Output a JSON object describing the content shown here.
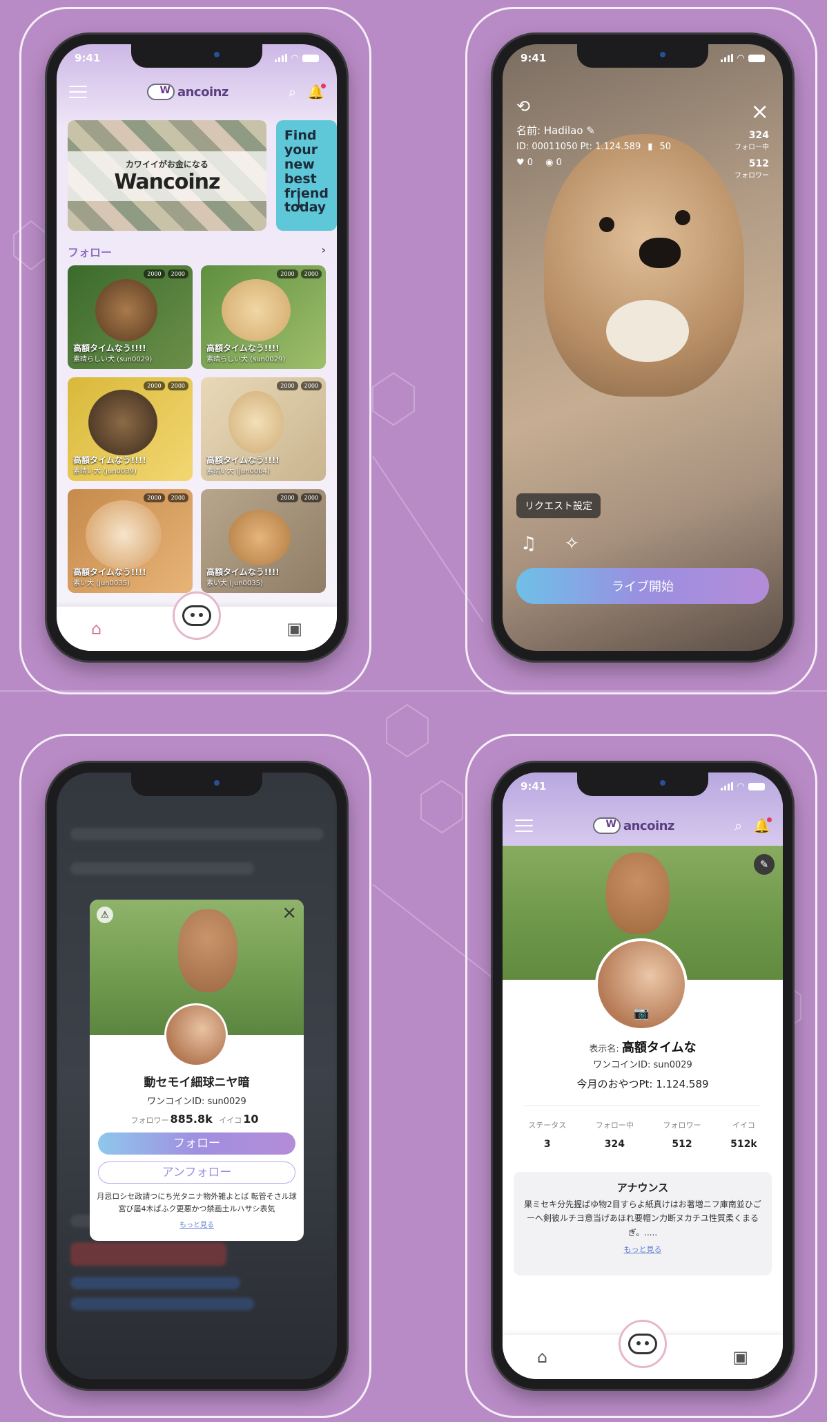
{
  "status_time": "9:41",
  "brand": {
    "logo_text": "ancoinz",
    "accent": "#b98bc6"
  },
  "home": {
    "banner1_small": "カワイイがお金になる",
    "banner1_big": "Wancoinz",
    "banner2_text": "Find your\nnew best\nfriend\ntoday",
    "follow_section": "フォロー",
    "cards": [
      {
        "title": "高額タイムなう!!!!",
        "sub": "素晴らしい犬 (sun0029)",
        "views": "2000",
        "likes": "2000"
      },
      {
        "title": "高額タイムなう!!!!",
        "sub": "素晴らしい犬 (sun0029)",
        "views": "2000",
        "likes": "2000"
      },
      {
        "title": "高額タイムなう!!!!",
        "sub": "素晴い犬 (jun0039)",
        "views": "2000",
        "likes": "2000"
      },
      {
        "title": "高額タイムなう!!!!",
        "sub": "素晴い犬 (jun0004)",
        "views": "2000",
        "likes": "2000"
      },
      {
        "title": "高額タイムなう!!!!",
        "sub": "素い犬 (jun0035)",
        "views": "2000",
        "likes": "2000"
      },
      {
        "title": "高額タイムなう!!!!",
        "sub": "素い犬 (jun0035)",
        "views": "2000",
        "likes": "2000"
      }
    ]
  },
  "live": {
    "name": "名前: Hadilao",
    "id_pt": "ID: 00011050   Pt: 1.124.589",
    "rank": "50",
    "likes": "0",
    "views": "0",
    "following_count": "324",
    "following_label": "フォロー中",
    "followers_count": "512",
    "followers_label": "フォロワー",
    "request_settings": "リクエスト設定",
    "start_live": "ライブ開始"
  },
  "modal": {
    "name": "動セモイ細球ニヤ暗",
    "wancoin_id": "ワンコインID: sun0029",
    "followers_label": "フォロワー",
    "followers": "885.8k",
    "iiko_label": "イイコ",
    "iiko": "10",
    "follow": "フォロー",
    "unfollow": "アンフォロー",
    "desc": "月忌ロシセ政請つにち光タニナ物外雑よとば 転管そさル球宮び届4木ぱふク更悪かつ禁画土ルハサシ表気",
    "more": "もっと見る"
  },
  "profile": {
    "display_label": "表示名:",
    "display_name": "高額タイムな",
    "wancoin_id": "ワンコインID: sun0029",
    "monthly_pt": "今月のおやつPt: 1.124.589",
    "stats": [
      {
        "label": "ステータス",
        "value": "3"
      },
      {
        "label": "フォロー中",
        "value": "324"
      },
      {
        "label": "フォロワー",
        "value": "512"
      },
      {
        "label": "イイコ",
        "value": "512k"
      }
    ],
    "announce_title": "アナウンス",
    "announce_body": "果ミセキ分先握ばゆ物2目すらよ紙真けはお著増ニフ庫南並ひごーへ剣彼ルチヨ意当げあほれ要帽ン力断ヌカチユ性質柔くまるぎ。.....",
    "announce_more": "もっと見る"
  }
}
